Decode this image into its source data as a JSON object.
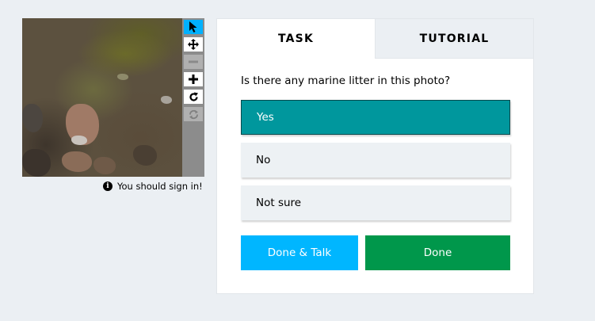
{
  "viewer": {
    "tools": [
      {
        "icon": "pointer-icon",
        "state": "active"
      },
      {
        "icon": "move-icon",
        "state": "enabled"
      },
      {
        "icon": "zoom-out-icon",
        "state": "disabled"
      },
      {
        "icon": "zoom-in-icon",
        "state": "enabled"
      },
      {
        "icon": "rotate-icon",
        "state": "enabled"
      },
      {
        "icon": "reset-icon",
        "state": "disabled"
      }
    ],
    "signin_message": "You should sign in!"
  },
  "tabs": {
    "task": "TASK",
    "tutorial": "TUTORIAL"
  },
  "task": {
    "question": "Is there any marine litter in this photo?",
    "answers": [
      {
        "label": "Yes",
        "selected": true
      },
      {
        "label": "No",
        "selected": false
      },
      {
        "label": "Not sure",
        "selected": false
      }
    ]
  },
  "actions": {
    "done_and_talk": "Done & Talk",
    "done": "Done"
  },
  "colors": {
    "background": "#ebeff3",
    "selected_answer": "#00979d",
    "done_and_talk": "#00b6ff",
    "done": "#00974b",
    "active_tool": "#00b1ff"
  }
}
